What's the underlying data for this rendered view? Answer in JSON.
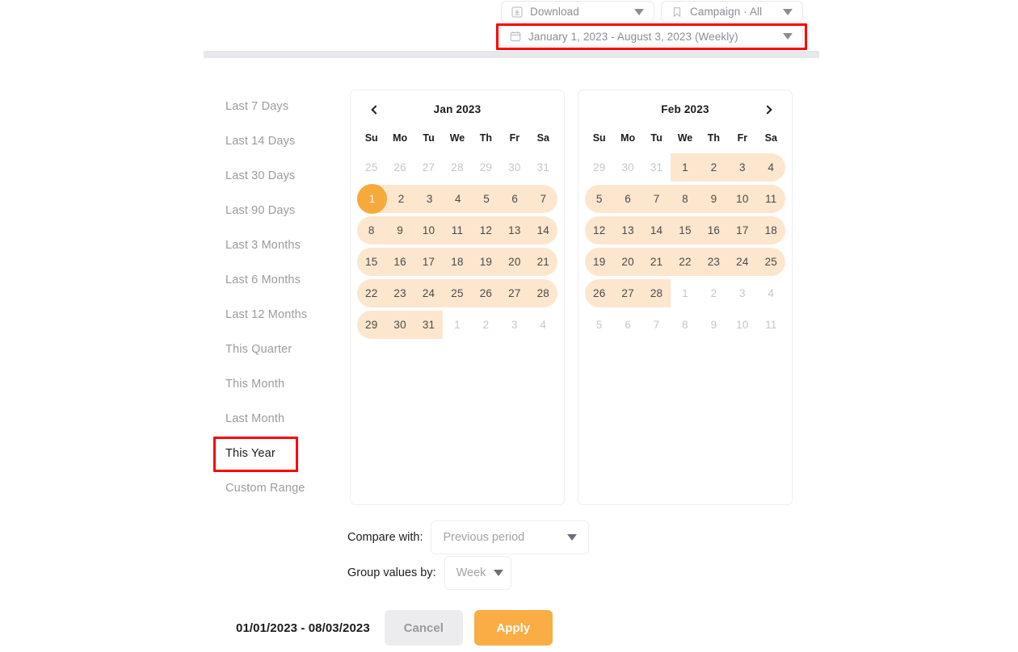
{
  "header": {
    "download_label": "Download",
    "download_icon": "download-box-icon",
    "campaign_label": "Campaign · All",
    "campaign_icon": "bookmark-icon",
    "daterange_label": "January 1, 2023 - August 3, 2023 (Weekly)",
    "daterange_icon": "calendar-icon",
    "caret_icon": "caret-down-icon",
    "highlight_color": "#ff0000"
  },
  "presets": {
    "items": [
      {
        "label": "Last 7 Days",
        "selected": false,
        "highlighted": false
      },
      {
        "label": "Last 14 Days",
        "selected": false,
        "highlighted": false
      },
      {
        "label": "Last 30 Days",
        "selected": false,
        "highlighted": false
      },
      {
        "label": "Last 90 Days",
        "selected": false,
        "highlighted": false
      },
      {
        "label": "Last 3 Months",
        "selected": false,
        "highlighted": false
      },
      {
        "label": "Last 6 Months",
        "selected": false,
        "highlighted": false
      },
      {
        "label": "Last 12 Months",
        "selected": false,
        "highlighted": false
      },
      {
        "label": "This Quarter",
        "selected": false,
        "highlighted": false
      },
      {
        "label": "This Month",
        "selected": false,
        "highlighted": false
      },
      {
        "label": "Last Month",
        "selected": false,
        "highlighted": false
      },
      {
        "label": "This Year",
        "selected": true,
        "highlighted": true
      },
      {
        "label": "Custom Range",
        "selected": false,
        "highlighted": false
      }
    ]
  },
  "calendars": {
    "weekdays": [
      "Su",
      "Mo",
      "Tu",
      "We",
      "Th",
      "Fr",
      "Sa"
    ],
    "prev_arrow_icon": "chevron-left-icon",
    "next_arrow_icon": "chevron-right-icon",
    "selection_band_color": "#fce6cd",
    "endpoint_color": "#f7a93c",
    "months": [
      {
        "title": "Jan 2023",
        "show_prev": true,
        "show_next": false,
        "weeks": [
          {
            "band": null,
            "days": [
              {
                "n": "25",
                "muted": true
              },
              {
                "n": "26",
                "muted": true
              },
              {
                "n": "27",
                "muted": true
              },
              {
                "n": "28",
                "muted": true
              },
              {
                "n": "29",
                "muted": true
              },
              {
                "n": "30",
                "muted": true
              },
              {
                "n": "31",
                "muted": true
              }
            ]
          },
          {
            "band": {
              "start": 0,
              "end": 6,
              "round_left": true,
              "round_right": true
            },
            "days": [
              {
                "n": "1",
                "muted": false,
                "endpoint": true
              },
              {
                "n": "2",
                "muted": false
              },
              {
                "n": "3",
                "muted": false
              },
              {
                "n": "4",
                "muted": false
              },
              {
                "n": "5",
                "muted": false
              },
              {
                "n": "6",
                "muted": false
              },
              {
                "n": "7",
                "muted": false
              }
            ]
          },
          {
            "band": {
              "start": 0,
              "end": 6,
              "round_left": true,
              "round_right": true
            },
            "days": [
              {
                "n": "8",
                "muted": false
              },
              {
                "n": "9",
                "muted": false
              },
              {
                "n": "10",
                "muted": false
              },
              {
                "n": "11",
                "muted": false
              },
              {
                "n": "12",
                "muted": false
              },
              {
                "n": "13",
                "muted": false
              },
              {
                "n": "14",
                "muted": false
              }
            ]
          },
          {
            "band": {
              "start": 0,
              "end": 6,
              "round_left": true,
              "round_right": true
            },
            "days": [
              {
                "n": "15",
                "muted": false
              },
              {
                "n": "16",
                "muted": false
              },
              {
                "n": "17",
                "muted": false
              },
              {
                "n": "18",
                "muted": false
              },
              {
                "n": "19",
                "muted": false
              },
              {
                "n": "20",
                "muted": false
              },
              {
                "n": "21",
                "muted": false
              }
            ]
          },
          {
            "band": {
              "start": 0,
              "end": 6,
              "round_left": true,
              "round_right": true
            },
            "days": [
              {
                "n": "22",
                "muted": false
              },
              {
                "n": "23",
                "muted": false
              },
              {
                "n": "24",
                "muted": false
              },
              {
                "n": "25",
                "muted": false
              },
              {
                "n": "26",
                "muted": false
              },
              {
                "n": "27",
                "muted": false
              },
              {
                "n": "28",
                "muted": false
              }
            ]
          },
          {
            "band": {
              "start": 0,
              "end": 2,
              "round_left": true,
              "round_right": false
            },
            "days": [
              {
                "n": "29",
                "muted": false
              },
              {
                "n": "30",
                "muted": false
              },
              {
                "n": "31",
                "muted": false
              },
              {
                "n": "1",
                "muted": true
              },
              {
                "n": "2",
                "muted": true
              },
              {
                "n": "3",
                "muted": true
              },
              {
                "n": "4",
                "muted": true
              }
            ]
          }
        ]
      },
      {
        "title": "Feb 2023",
        "show_prev": false,
        "show_next": true,
        "weeks": [
          {
            "band": {
              "start": 3,
              "end": 6,
              "round_left": false,
              "round_right": true
            },
            "days": [
              {
                "n": "29",
                "muted": true
              },
              {
                "n": "30",
                "muted": true
              },
              {
                "n": "31",
                "muted": true
              },
              {
                "n": "1",
                "muted": false
              },
              {
                "n": "2",
                "muted": false
              },
              {
                "n": "3",
                "muted": false
              },
              {
                "n": "4",
                "muted": false
              }
            ]
          },
          {
            "band": {
              "start": 0,
              "end": 6,
              "round_left": true,
              "round_right": true
            },
            "days": [
              {
                "n": "5",
                "muted": false
              },
              {
                "n": "6",
                "muted": false
              },
              {
                "n": "7",
                "muted": false
              },
              {
                "n": "8",
                "muted": false
              },
              {
                "n": "9",
                "muted": false
              },
              {
                "n": "10",
                "muted": false
              },
              {
                "n": "11",
                "muted": false
              }
            ]
          },
          {
            "band": {
              "start": 0,
              "end": 6,
              "round_left": true,
              "round_right": true
            },
            "days": [
              {
                "n": "12",
                "muted": false
              },
              {
                "n": "13",
                "muted": false
              },
              {
                "n": "14",
                "muted": false
              },
              {
                "n": "15",
                "muted": false
              },
              {
                "n": "16",
                "muted": false
              },
              {
                "n": "17",
                "muted": false
              },
              {
                "n": "18",
                "muted": false
              }
            ]
          },
          {
            "band": {
              "start": 0,
              "end": 6,
              "round_left": true,
              "round_right": true
            },
            "days": [
              {
                "n": "19",
                "muted": false
              },
              {
                "n": "20",
                "muted": false
              },
              {
                "n": "21",
                "muted": false
              },
              {
                "n": "22",
                "muted": false
              },
              {
                "n": "23",
                "muted": false
              },
              {
                "n": "24",
                "muted": false
              },
              {
                "n": "25",
                "muted": false
              }
            ]
          },
          {
            "band": {
              "start": 0,
              "end": 2,
              "round_left": true,
              "round_right": false
            },
            "days": [
              {
                "n": "26",
                "muted": false
              },
              {
                "n": "27",
                "muted": false
              },
              {
                "n": "28",
                "muted": false
              },
              {
                "n": "1",
                "muted": true
              },
              {
                "n": "2",
                "muted": true
              },
              {
                "n": "3",
                "muted": true
              },
              {
                "n": "4",
                "muted": true
              }
            ]
          },
          {
            "band": null,
            "days": [
              {
                "n": "5",
                "muted": true
              },
              {
                "n": "6",
                "muted": true
              },
              {
                "n": "7",
                "muted": true
              },
              {
                "n": "8",
                "muted": true
              },
              {
                "n": "9",
                "muted": true
              },
              {
                "n": "10",
                "muted": true
              },
              {
                "n": "11",
                "muted": true
              }
            ]
          }
        ]
      }
    ]
  },
  "options": {
    "compare_label": "Compare with:",
    "compare_value": "Previous period",
    "group_label": "Group values by:",
    "group_value": "Week",
    "caret_icon": "caret-down-icon"
  },
  "footer": {
    "selected_range": "01/01/2023 - 08/03/2023",
    "cancel_label": "Cancel",
    "apply_label": "Apply",
    "apply_color": "#f9ad44"
  }
}
